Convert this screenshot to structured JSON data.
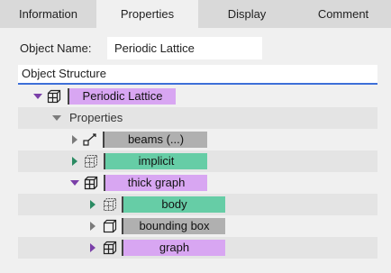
{
  "tabs": [
    {
      "label": "Information"
    },
    {
      "label": "Properties"
    },
    {
      "label": "Display"
    },
    {
      "label": "Comment"
    }
  ],
  "object_name": {
    "label": "Object Name:",
    "value": "Periodic Lattice"
  },
  "structure": {
    "header": "Object Structure"
  },
  "tree": {
    "root": {
      "label": "Periodic Lattice",
      "color": "#d8a6f2",
      "arrow_color": "#7a3fa8"
    },
    "properties": {
      "label": "Properties"
    },
    "beams": {
      "label": "beams (...)",
      "color": "#b0b0b0"
    },
    "implicit": {
      "label": "implicit",
      "color": "#66cda6",
      "arrow_color": "#2a8a62"
    },
    "thick_graph": {
      "label": "thick graph",
      "color": "#d8a6f2",
      "arrow_color": "#7a3fa8"
    },
    "body": {
      "label": "body",
      "color": "#66cda6",
      "arrow_color": "#2a8a62"
    },
    "bounding_box": {
      "label": "bounding box",
      "color": "#b0b0b0"
    },
    "graph": {
      "label": "graph",
      "color": "#d8a6f2",
      "arrow_color": "#7a3fa8"
    }
  }
}
